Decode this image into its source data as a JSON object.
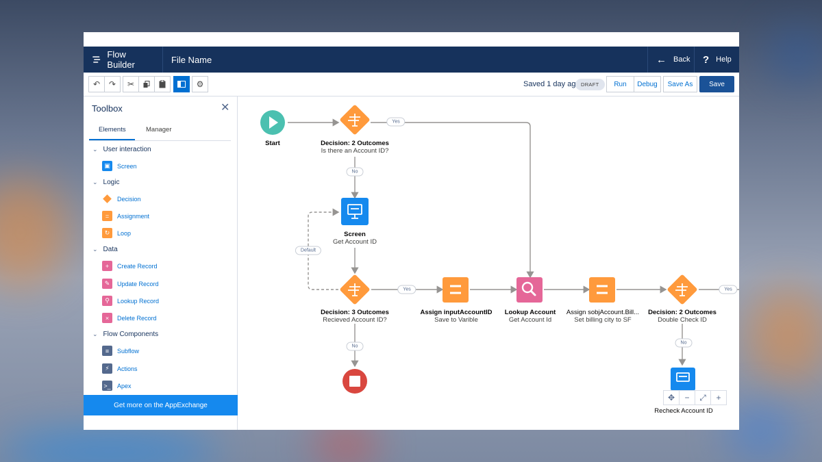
{
  "header": {
    "app_title": "Flow Builder",
    "file_name": "File Name",
    "back_label": "Back",
    "help_label": "Help"
  },
  "toolbar": {
    "saved_text": "Saved 1 day ago",
    "status_badge": "DRAFT",
    "run_label": "Run",
    "debug_label": "Debug",
    "save_as_label": "Save As",
    "save_label": "Save"
  },
  "toolbox": {
    "title": "Toolbox",
    "tabs": [
      "Elements",
      "Manager"
    ],
    "categories": [
      {
        "label": "User interaction",
        "items": [
          {
            "label": "Screen",
            "icon": "screen-icon",
            "color": "#1589ee"
          }
        ]
      },
      {
        "label": "Logic",
        "items": [
          {
            "label": "Decision",
            "icon": "decision-icon",
            "color": "#ff9a3c"
          },
          {
            "label": "Assignment",
            "icon": "assignment-icon",
            "color": "#ff9a3c"
          },
          {
            "label": "Loop",
            "icon": "loop-icon",
            "color": "#ff9a3c"
          }
        ]
      },
      {
        "label": "Data",
        "items": [
          {
            "label": "Create Record",
            "icon": "create-record-icon",
            "color": "#e56798"
          },
          {
            "label": "Update Record",
            "icon": "update-record-icon",
            "color": "#e56798"
          },
          {
            "label": "Lookup Record",
            "icon": "lookup-record-icon",
            "color": "#e56798"
          },
          {
            "label": "Delete Record",
            "icon": "delete-record-icon",
            "color": "#e56798"
          }
        ]
      },
      {
        "label": "Flow Components",
        "items": [
          {
            "label": "Subflow",
            "icon": "subflow-icon",
            "color": "#54698d"
          },
          {
            "label": "Actions",
            "icon": "actions-icon",
            "color": "#54698d"
          },
          {
            "label": "Apex",
            "icon": "apex-icon",
            "color": "#54698d"
          }
        ]
      }
    ],
    "appexchange_label": "Get more on the AppExchange"
  },
  "canvas": {
    "nodes": [
      {
        "id": "start",
        "title": "Start",
        "subtitle": ""
      },
      {
        "id": "decision1",
        "title": "Decision: 2 Outcomes",
        "subtitle": "Is there an Account ID?"
      },
      {
        "id": "screen1",
        "title": "Screen",
        "subtitle": "Get Account ID"
      },
      {
        "id": "decision2",
        "title": "Decision: 3 Outcomes",
        "subtitle": "Recieved Account ID?"
      },
      {
        "id": "assign1",
        "title": "Assign inputAccountID",
        "subtitle": "Save to Varible"
      },
      {
        "id": "lookup1",
        "title": "Lookup Account",
        "subtitle": "Get Account Id"
      },
      {
        "id": "assign2",
        "title": "Assign sobjAccount.Bill...",
        "subtitle": "Set billing city to SF"
      },
      {
        "id": "decision3",
        "title": "Decision: 2 Outcomes",
        "subtitle": "Double Check ID"
      },
      {
        "id": "screen2",
        "title": "Recheck  Account ID",
        "subtitle": ""
      }
    ],
    "connector_labels": {
      "yes1": "Yes",
      "no1": "No",
      "default": "Default",
      "yes2": "Yes",
      "no2": "No",
      "yes3": "Yes",
      "no3": "No"
    }
  },
  "colors": {
    "header_bg": "#16325c",
    "accent": "#0070d2",
    "start": "#4bc0b0",
    "decision": "#ff9a3c",
    "screen": "#1589ee",
    "record": "#e56798",
    "end": "#d9473f"
  }
}
